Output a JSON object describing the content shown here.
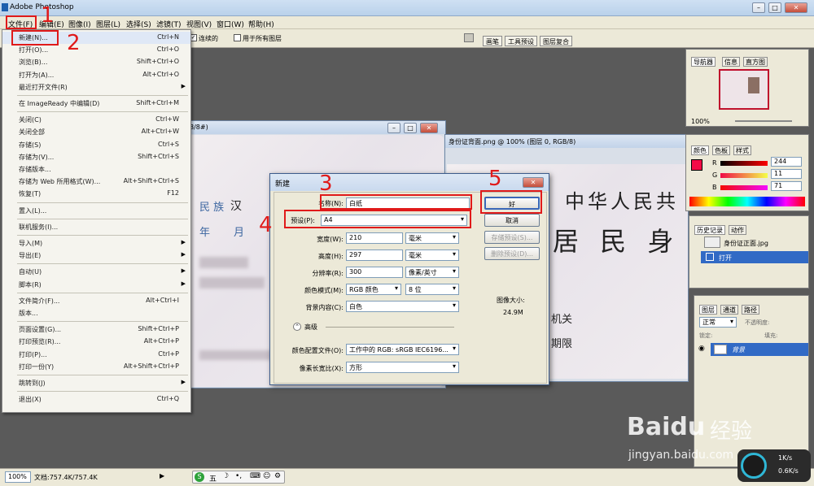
{
  "app": {
    "title": "Adobe Photoshop"
  },
  "menubar": [
    "文件(F)",
    "编辑(E)",
    "图像(I)",
    "图层(L)",
    "选择(S)",
    "滤镜(T)",
    "视图(V)",
    "窗口(W)",
    "帮助(H)"
  ],
  "options": {
    "contiguous": "连续的",
    "all_layers": "用于所有图层",
    "tab_brush": "画笔",
    "tab_tool_presets": "工具预设",
    "tab_layer_comps": "图层复合"
  },
  "file_menu": [
    {
      "label": "新建(N)...",
      "shortcut": "Ctrl+N"
    },
    {
      "label": "打开(O)...",
      "shortcut": "Ctrl+O"
    },
    {
      "label": "浏览(B)...",
      "shortcut": "Shift+Ctrl+O"
    },
    {
      "label": "打开为(A)...",
      "shortcut": "Alt+Ctrl+O"
    },
    {
      "label": "最近打开文件(R)",
      "shortcut": "",
      "submenu": true
    },
    {
      "sep": true
    },
    {
      "label": "在 ImageReady 中编辑(D)",
      "shortcut": "Shift+Ctrl+M"
    },
    {
      "sep": true
    },
    {
      "label": "关闭(C)",
      "shortcut": "Ctrl+W"
    },
    {
      "label": "关闭全部",
      "shortcut": "Alt+Ctrl+W"
    },
    {
      "label": "存储(S)",
      "shortcut": "Ctrl+S"
    },
    {
      "label": "存储为(V)...",
      "shortcut": "Shift+Ctrl+S"
    },
    {
      "label": "存储版本...",
      "shortcut": ""
    },
    {
      "label": "存储为 Web 所用格式(W)...",
      "shortcut": "Alt+Shift+Ctrl+S"
    },
    {
      "label": "恢复(T)",
      "shortcut": "F12"
    },
    {
      "sep": true
    },
    {
      "label": "置入(L)...",
      "shortcut": ""
    },
    {
      "sep": true
    },
    {
      "label": "联机服务(I)...",
      "shortcut": ""
    },
    {
      "sep": true
    },
    {
      "label": "导入(M)",
      "shortcut": "",
      "submenu": true
    },
    {
      "label": "导出(E)",
      "shortcut": "",
      "submenu": true
    },
    {
      "sep": true
    },
    {
      "label": "自动(U)",
      "shortcut": "",
      "submenu": true
    },
    {
      "label": "脚本(R)",
      "shortcut": "",
      "submenu": true
    },
    {
      "sep": true
    },
    {
      "label": "文件简介(F)...",
      "shortcut": "Alt+Ctrl+I"
    },
    {
      "label": "版本...",
      "shortcut": ""
    },
    {
      "sep": true
    },
    {
      "label": "页面设置(G)...",
      "shortcut": "Shift+Ctrl+P"
    },
    {
      "label": "打印预览(R)...",
      "shortcut": "Alt+Ctrl+P"
    },
    {
      "label": "打印(P)...",
      "shortcut": "Ctrl+P"
    },
    {
      "label": "打印一份(Y)",
      "shortcut": "Alt+Shift+Ctrl+P"
    },
    {
      "sep": true
    },
    {
      "label": "跳转到(J)",
      "shortcut": "",
      "submenu": true
    },
    {
      "sep": true
    },
    {
      "label": "退出(X)",
      "shortcut": "Ctrl+Q"
    }
  ],
  "doc_left": {
    "title": "8/8#)",
    "text1": "民 族",
    "text2": "汉",
    "text3": "年",
    "text4": "月"
  },
  "doc_right": {
    "title": "身份证背面.png @ 100% (图层 0, RGB/8)",
    "head1": "中华人民共",
    "head2": "居 民 身 份",
    "label1": "机关",
    "label2": "期限"
  },
  "dialog": {
    "title": "新建",
    "name_label": "名称(N):",
    "name_value": "白纸",
    "preset_label": "预设(P):",
    "preset_value": "A4",
    "width_label": "宽度(W):",
    "width_value": "210",
    "width_unit": "毫米",
    "height_label": "高度(H):",
    "height_value": "297",
    "height_unit": "毫米",
    "res_label": "分辨率(R):",
    "res_value": "300",
    "res_unit": "像素/英寸",
    "mode_label": "颜色模式(M):",
    "mode_value": "RGB 颜色",
    "mode_bits": "8 位",
    "bg_label": "背景内容(C):",
    "bg_value": "白色",
    "advanced": "高级",
    "profile_label": "颜色配置文件(O):",
    "profile_value": "工作中的 RGB: sRGB IEC6196...",
    "aspect_label": "像素长宽比(X):",
    "aspect_value": "方形",
    "ok": "好",
    "cancel": "取消",
    "save_preset": "存储预设(S)...",
    "delete_preset": "删除预设(D)...",
    "size_label": "图像大小:",
    "size_value": "24.9M"
  },
  "annotations": [
    "1",
    "2",
    "3",
    "4",
    "5"
  ],
  "navigator": {
    "tabs": [
      "导航器",
      "信息",
      "直方图"
    ],
    "zoom": "100%"
  },
  "color_panel": {
    "tabs": [
      "颜色",
      "色板",
      "样式"
    ],
    "r_label": "R",
    "g_label": "G",
    "b_label": "B",
    "r": "244",
    "g": "11",
    "b": "71"
  },
  "history": {
    "tabs": [
      "历史记录",
      "动作"
    ],
    "snapshot": "身份证正面.jpg",
    "step": "打开"
  },
  "layers": {
    "tabs": [
      "图层",
      "通道",
      "路径"
    ],
    "mode": "正常",
    "opacity_label": "不透明度:",
    "lock_label": "锁定:",
    "fill_label": "填充:",
    "layer": "背景"
  },
  "status": {
    "zoom": "100%",
    "doc": "文档:757.4K/757.4K"
  },
  "ime": {
    "label": "五"
  },
  "speed": {
    "up": "1K/s",
    "down": "0.6K/s"
  },
  "watermark": {
    "brand": "Baidu",
    "cn": "经验",
    "url": "jingyan.baidu.com"
  },
  "colors": {
    "accent_red": "#e01a1a",
    "fg_swatch": "#f40b47",
    "selection_blue": "#316ac5"
  }
}
